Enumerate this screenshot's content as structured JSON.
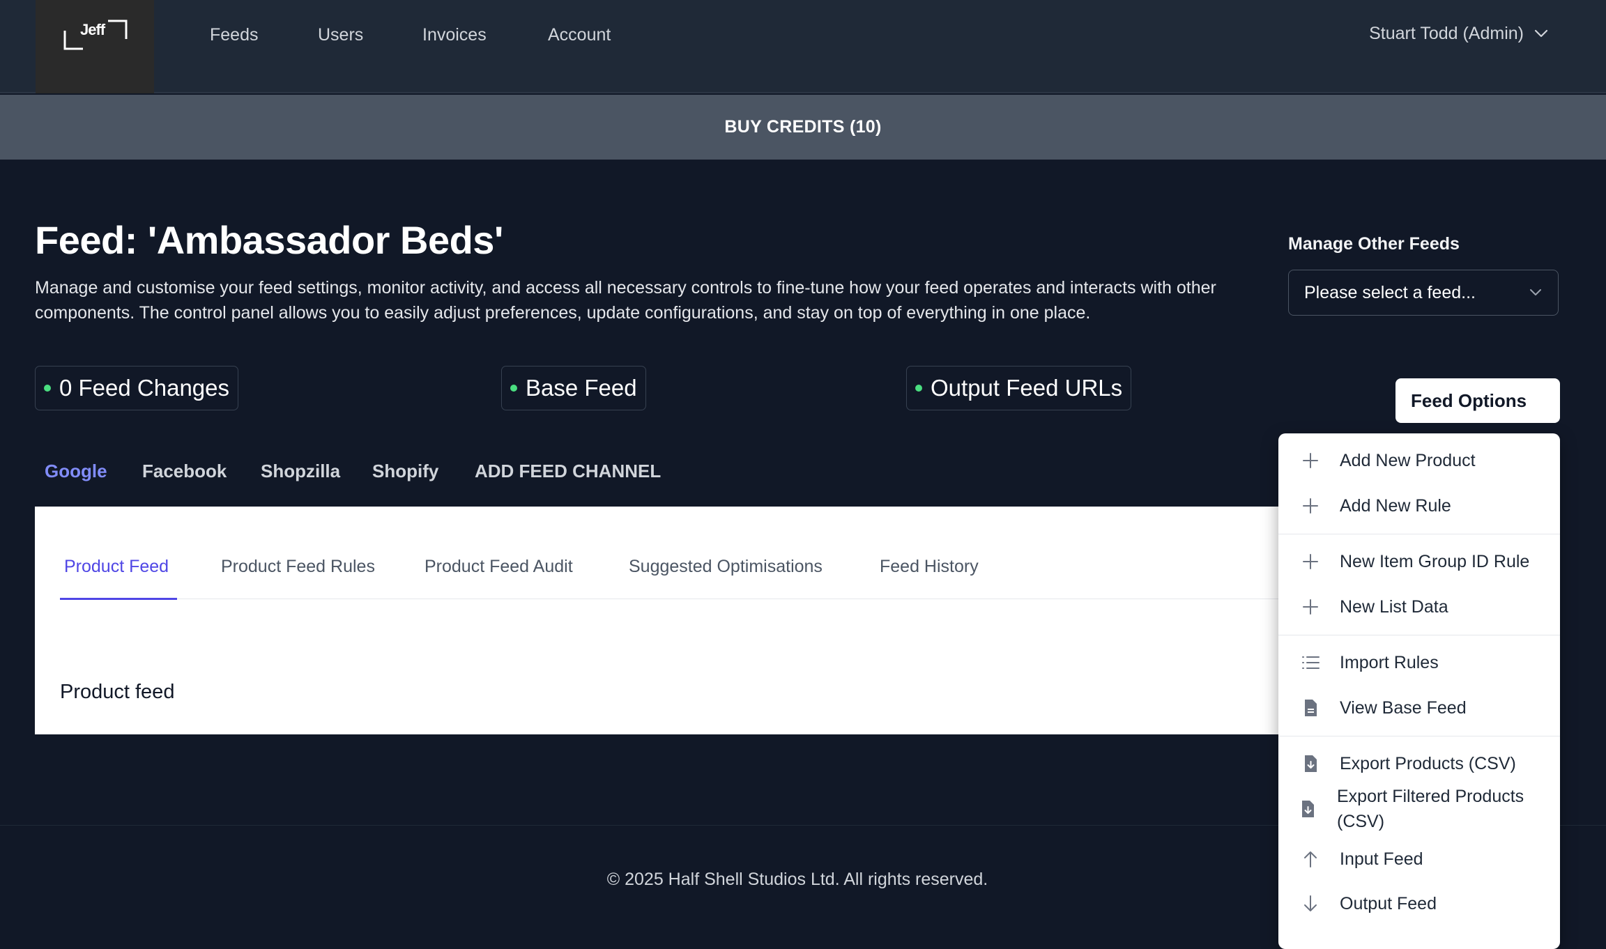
{
  "nav": {
    "logo_text": "Jeff",
    "links": [
      "Feeds",
      "Users",
      "Invoices",
      "Account"
    ],
    "user_label": "Stuart Todd (Admin)"
  },
  "credits": {
    "label": "BUY CREDITS (10)"
  },
  "header": {
    "title": "Feed: 'Ambassador Beds'",
    "description": "Manage and customise your feed settings, monitor activity, and access all necessary controls to fine-tune how your feed operates and interacts with other components. The control panel allows you to easily adjust preferences, update configurations, and stay on top of everything in one place.",
    "other_feeds_label": "Manage Other Feeds",
    "feed_select_placeholder": "Please select a feed..."
  },
  "status": {
    "feed_changes": "0 Feed Changes",
    "base_feed": "Base Feed",
    "output_urls": "Output Feed URLs",
    "dot_color": "#4ade80"
  },
  "feed_options": {
    "label": "Feed Options"
  },
  "channels": {
    "tabs": [
      "Google",
      "Facebook",
      "Shopzilla",
      "Shopify",
      "ADD FEED CHANNEL"
    ],
    "active": "Google"
  },
  "panel": {
    "tabs": [
      "Product Feed",
      "Product Feed Rules",
      "Product Feed Audit",
      "Suggested Optimisations",
      "Feed History"
    ],
    "active": "Product Feed",
    "content_label": "Product feed"
  },
  "menu": {
    "items": [
      {
        "label": "Add New Product",
        "icon": "plus-icon"
      },
      {
        "label": "Add New Rule",
        "icon": "plus-icon"
      },
      {
        "label": "New Item Group ID Rule",
        "icon": "plus-icon"
      },
      {
        "label": "New List Data",
        "icon": "plus-icon"
      },
      {
        "label": "Import Rules",
        "icon": "list-icon"
      },
      {
        "label": "View Base Feed",
        "icon": "document-icon"
      },
      {
        "label": "Export Products (CSV)",
        "icon": "document-download-icon"
      },
      {
        "label": "Export Filtered Products (CSV)",
        "icon": "document-download-icon"
      },
      {
        "label": "Input Feed",
        "icon": "arrow-up-icon"
      },
      {
        "label": "Output Feed",
        "icon": "arrow-down-icon"
      }
    ]
  },
  "footer": {
    "text": "© 2025 Half Shell Studios Ltd. All rights reserved."
  },
  "colors": {
    "background": "#111827",
    "nav_background": "#1f2937",
    "credits_bar": "#4b5563",
    "accent": "#4f46e5",
    "channel_active": "#818cf8"
  }
}
